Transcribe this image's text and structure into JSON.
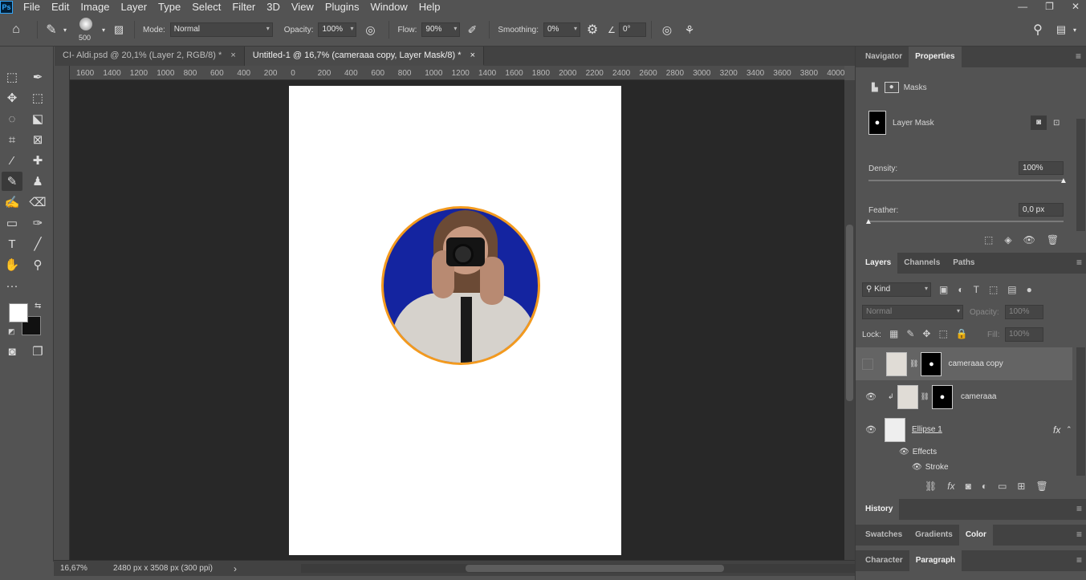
{
  "app": {
    "logo": "Ps"
  },
  "menu": [
    "File",
    "Edit",
    "Image",
    "Layer",
    "Type",
    "Select",
    "Filter",
    "3D",
    "View",
    "Plugins",
    "Window",
    "Help"
  ],
  "window_controls": [
    "—",
    "❐",
    "✕"
  ],
  "options": {
    "brush_size": "500",
    "mode_label": "Mode:",
    "mode_value": "Normal",
    "opacity_label": "Opacity:",
    "opacity_value": "100%",
    "flow_label": "Flow:",
    "flow_value": "90%",
    "smoothing_label": "Smoothing:",
    "smoothing_value": "0%",
    "angle_value": "0°"
  },
  "tabs": [
    {
      "label": "CI- Aldi.psd @ 20,1% (Layer 2, RGB/8) *",
      "close": "×"
    },
    {
      "label": "Untitled-1 @ 16,7% (cameraaa copy, Layer Mask/8) *",
      "close": "×"
    }
  ],
  "ruler": [
    "1600",
    "1400",
    "1200",
    "1000",
    "800",
    "600",
    "400",
    "200",
    "0",
    "200",
    "400",
    "600",
    "800",
    "1000",
    "1200",
    "1400",
    "1600",
    "1800",
    "2000",
    "2200",
    "2400",
    "2600",
    "2800",
    "3000",
    "3200",
    "3400",
    "3600",
    "3800",
    "4000"
  ],
  "status": {
    "zoom": "16,67%",
    "doc_info": "2480 px x 3508 px (300 ppi)",
    "arrow": "›"
  },
  "properties_panel": {
    "tabs": [
      "Navigator",
      "Properties"
    ],
    "masks_label": "Masks",
    "layer_mask_label": "Layer Mask",
    "density_label": "Density:",
    "density_value": "100%",
    "density_level": 1.0,
    "feather_label": "Feather:",
    "feather_value": "0,0 px",
    "feather_level": 0.0
  },
  "layers_panel": {
    "tabs": [
      "Layers",
      "Channels",
      "Paths"
    ],
    "filter_kind": "Kind",
    "blend_mode": "Normal",
    "opacity_label": "Opacity:",
    "opacity_value": "100%",
    "lock_label": "Lock:",
    "fill_label": "Fill:",
    "fill_value": "100%",
    "layers": [
      {
        "name": "cameraaa copy",
        "visible": false,
        "selected": true
      },
      {
        "name": "cameraaa",
        "visible": true,
        "selected": false
      },
      {
        "name": "Ellipse 1",
        "visible": true,
        "selected": false,
        "fx": "fx"
      }
    ],
    "effects_label": "Effects",
    "stroke_label": "Stroke"
  },
  "history_panel": {
    "tabs": [
      "History"
    ]
  },
  "color_panel": {
    "tabs": [
      "Swatches",
      "Gradients",
      "Color"
    ]
  },
  "char_panel": {
    "tabs": [
      "Character",
      "Paragraph"
    ]
  },
  "colors": {
    "stroke_orange": "#f39a1e",
    "ellipse_blue": "#1424a0"
  }
}
